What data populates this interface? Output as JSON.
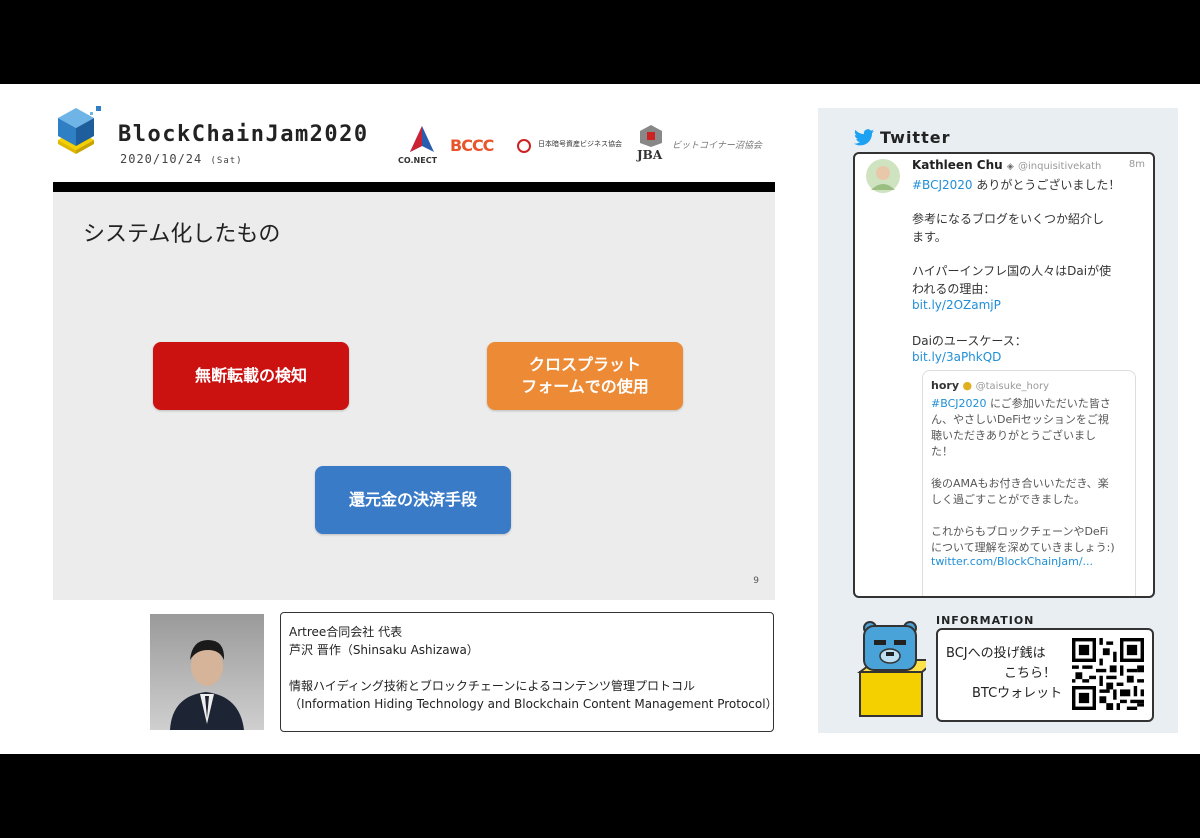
{
  "header": {
    "event_title": "BlockChainJam2020",
    "event_date": "2020/10/24",
    "event_day": "(Sat)",
    "sponsors": [
      "CO.NECT",
      "BCCC",
      "日本暗号資産ビジネス協会",
      "JBA",
      "ビットコイナー沼協会"
    ]
  },
  "slide": {
    "title": "システム化したもの",
    "box_red": "無断転載の検知",
    "box_orange_line1": "クロスプラット",
    "box_orange_line2": "フォームでの使用",
    "box_blue": "還元金の決済手段",
    "page_number": "9"
  },
  "speaker": {
    "line1": "Artree合同会社 代表",
    "line2": "芦沢 晋作（Shinsaku Ashizawa）",
    "line3": "情報ハイディング技術とブロックチェーンによるコンテンツ管理プロトコル",
    "line4": "（Information Hiding Technology and Blockchain Content Management Protocol）"
  },
  "twitter": {
    "header": "Twitter",
    "tweet": {
      "author": "Kathleen Chu",
      "handle": "@inquisitivekath",
      "time": "8m",
      "hashtag": "#BCJ2020",
      "line1": " ありがとうございました！",
      "line2": "参考になるブログをいくつか紹介し",
      "line3": "ます。",
      "line4": "ハイパーインフレ国の人々はDaiが使",
      "line5": "われるの理由：",
      "link1": "bit.ly/2OZamjP",
      "line6": "Daiのユースケース：",
      "link2": "bit.ly/3aPhkQD"
    },
    "quote": {
      "author": "hory",
      "handle": "@taisuke_hory",
      "hashtag": "#BCJ2020",
      "line1": " にご参加いただいた皆さ",
      "line2": "ん、やさしいDeFiセッションをご視",
      "line3": "聴いただきありがとうございまし",
      "line4": "た！",
      "line5": "後のAMAもお付き合いいただき、楽",
      "line6": "しく過ごすことができました。",
      "line7": "これからもブロックチェーンやDeFi",
      "line8": "について理解を深めていきましょう:)",
      "link": "twitter.com/BlockChainJam/..."
    }
  },
  "information": {
    "label": "INFORMATION",
    "line1": "BCJへの投げ銭は",
    "line2": "こちら！",
    "line3": "BTCウォレット"
  }
}
